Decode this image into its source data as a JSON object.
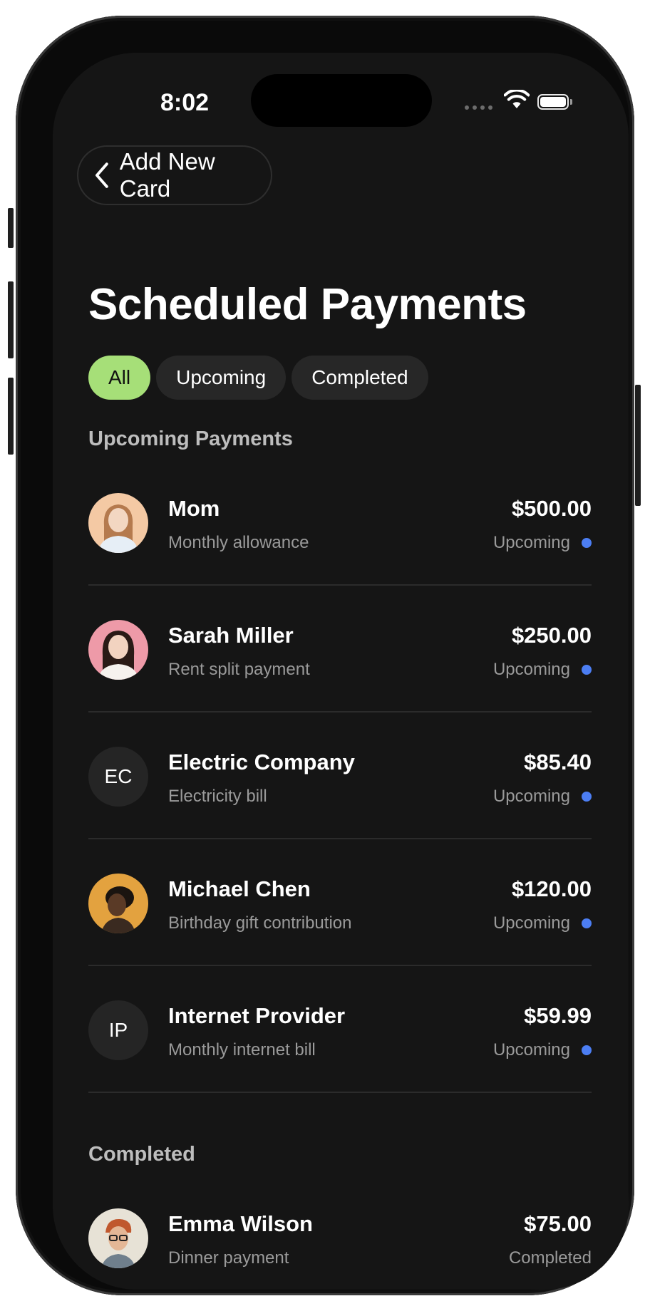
{
  "status_bar": {
    "time": "8:02"
  },
  "nav": {
    "back_label": "Add New Card"
  },
  "page": {
    "title": "Scheduled Payments"
  },
  "filters": [
    {
      "label": "All",
      "active": true
    },
    {
      "label": "Upcoming",
      "active": false
    },
    {
      "label": "Completed",
      "active": false
    }
  ],
  "sections": {
    "upcoming_title": "Upcoming Payments",
    "completed_title": "Completed"
  },
  "upcoming": [
    {
      "name": "Mom",
      "description": "Monthly allowance",
      "amount": "$500.00",
      "status": "Upcoming"
    },
    {
      "name": "Sarah Miller",
      "description": "Rent split payment",
      "amount": "$250.00",
      "status": "Upcoming"
    },
    {
      "name": "Electric Company",
      "initials": "EC",
      "description": "Electricity bill",
      "amount": "$85.40",
      "status": "Upcoming"
    },
    {
      "name": "Michael Chen",
      "description": "Birthday gift contribution",
      "amount": "$120.00",
      "status": "Upcoming"
    },
    {
      "name": "Internet Provider",
      "initials": "IP",
      "description": "Monthly internet bill",
      "amount": "$59.99",
      "status": "Upcoming"
    }
  ],
  "completed": [
    {
      "name": "Emma Wilson",
      "description": "Dinner payment",
      "amount": "$75.00",
      "status": "Completed"
    }
  ],
  "colors": {
    "background": "#151515",
    "accent_chip": "#a6df78",
    "status_dot": "#4c7ef3",
    "divider": "#2b2b2b"
  }
}
